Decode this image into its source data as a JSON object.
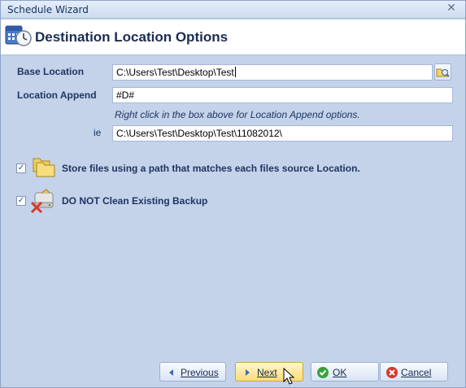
{
  "window": {
    "title": "Schedule Wizard"
  },
  "header": {
    "title": "Destination Location Options"
  },
  "form": {
    "base_location": {
      "label": "Base Location",
      "value": "C:\\Users\\Test\\Desktop\\Test"
    },
    "location_append": {
      "label": "Location Append",
      "value": "#D#"
    },
    "hint": "Right click in the box above for Location Append options.",
    "preview": {
      "label": "ie",
      "value": "C:\\Users\\Test\\Desktop\\Test\\11082012\\"
    }
  },
  "options": [
    {
      "label": "Store files using a path that matches each files source Location.",
      "checked": true,
      "icon": "folders-icon"
    },
    {
      "label": "DO NOT Clean Existing Backup",
      "checked": true,
      "icon": "no-clean-icon"
    }
  ],
  "buttons": {
    "previous": "Previous",
    "next": "Next",
    "ok": "OK",
    "cancel": "Cancel"
  },
  "colors": {
    "panel": "#c4d3ea",
    "label": "#1e3561",
    "hover_button": "#ffdc74"
  }
}
